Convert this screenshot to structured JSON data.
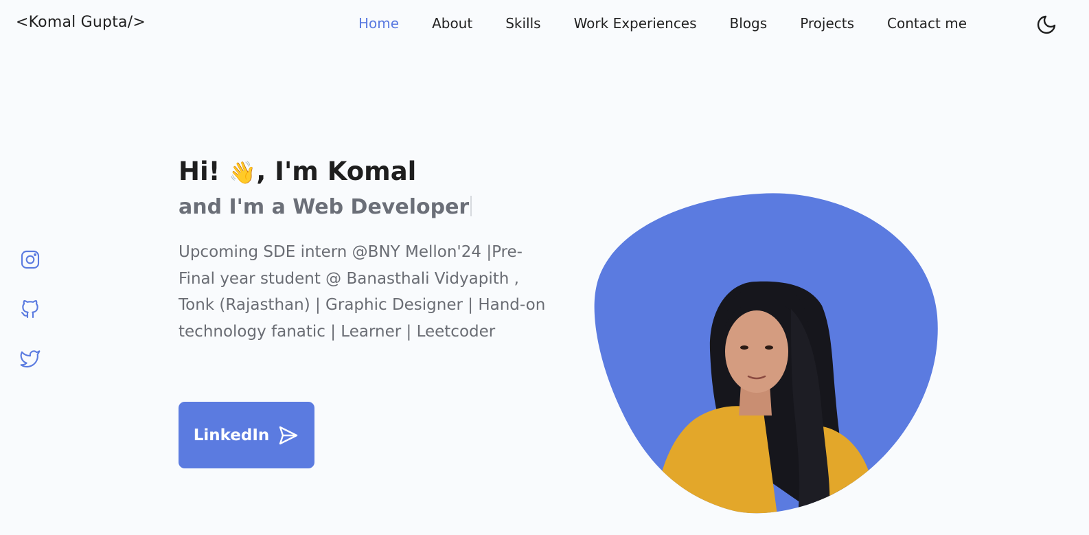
{
  "header": {
    "logo": "<Komal Gupta/>",
    "nav": [
      {
        "label": "Home",
        "active": true
      },
      {
        "label": "About",
        "active": false
      },
      {
        "label": "Skills",
        "active": false
      },
      {
        "label": "Work Experiences",
        "active": false
      },
      {
        "label": "Blogs",
        "active": false
      },
      {
        "label": "Projects",
        "active": false
      },
      {
        "label": "Contact me",
        "active": false
      }
    ],
    "theme_icon": "moon-icon"
  },
  "socials": [
    {
      "name": "instagram",
      "icon": "instagram-icon"
    },
    {
      "name": "github",
      "icon": "github-icon"
    },
    {
      "name": "twitter",
      "icon": "twitter-icon"
    }
  ],
  "hero": {
    "greeting_prefix": "Hi! ",
    "greeting_emoji": "👋",
    "greeting_suffix": ", I'm Komal",
    "subtitle": "and I'm a Web Developer",
    "bio": "Upcoming SDE intern @BNY Mellon'24 |Pre-Final year student @ Banasthali Vidyapith , Tonk (Rajasthan) | Graphic Designer | Hand-on technology fanatic | Learner | Leetcoder",
    "cta_label": "LinkedIn",
    "cta_icon": "send-icon"
  },
  "colors": {
    "accent": "#5b7be0",
    "background": "#f9fbfd",
    "text": "#1e1e1e",
    "muted": "#6a6d74"
  }
}
